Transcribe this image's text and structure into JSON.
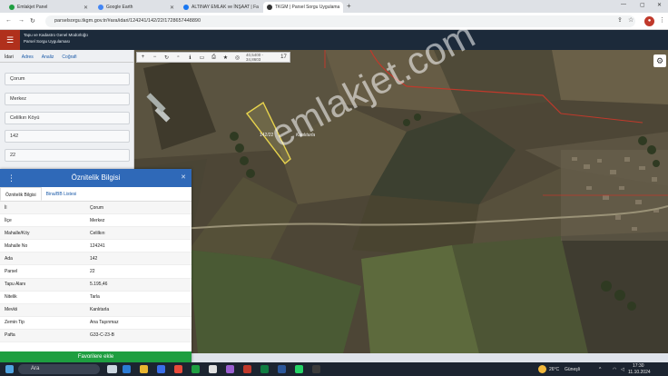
{
  "browser": {
    "tabs": [
      {
        "label": "Emlakjet Panel",
        "color": "#1e9e40"
      },
      {
        "label": "Google Earth",
        "color": "#4285f4"
      },
      {
        "label": "ALTINAY EMLAK ve İNŞAAT | Fa",
        "color": "#1877f2"
      },
      {
        "label": "TKGM | Parsel Sorgu Uygulama",
        "color": "#333333"
      }
    ],
    "url": "parselsorgu.tkgm.gov.tr/#ara/idari/124241/142/22/1728657448890",
    "new_tab": "+",
    "profile_initial": "●"
  },
  "header": {
    "line1": "Tapu ve Kadastro Genel Müdürlüğü",
    "line2": "Parsel Sorgu Uygulaması"
  },
  "left_panel": {
    "tabs": [
      "İdari",
      "Adres",
      "Analiz",
      "Coğrafi"
    ],
    "fields": [
      "Çorum",
      "Merkez",
      "Celilkırı Köyü",
      "142",
      "22"
    ]
  },
  "map": {
    "coords": "40,5400 - 34,8603",
    "zoom_label": "17",
    "kml_label": "Kanlıtarla",
    "watermark": "emlakjet.com",
    "parcel_label": "142/22"
  },
  "popup": {
    "title": "Öznitelik Bilgisi",
    "tabs": [
      "Öznitelik Bilgisi",
      "Bina/BB Listesi"
    ],
    "rows": [
      {
        "key": "İl",
        "value": "Çorum"
      },
      {
        "key": "İlçe",
        "value": "Merkez"
      },
      {
        "key": "Mahalle/Köy",
        "value": "Celilkırı"
      },
      {
        "key": "Mahalle No",
        "value": "124241"
      },
      {
        "key": "Ada",
        "value": "142"
      },
      {
        "key": "Parsel",
        "value": "22"
      },
      {
        "key": "Tapu Alanı",
        "value": "5.195,46"
      },
      {
        "key": "Nitelik",
        "value": "Tarla"
      },
      {
        "key": "Mevkii",
        "value": "Kanlıtarla"
      },
      {
        "key": "Zemin Tip",
        "value": "Ana Taşınmaz"
      },
      {
        "key": "Pafta",
        "value": "G33-C-23-B"
      }
    ],
    "favorite_button": "Favorilere ekle"
  },
  "taskbar": {
    "search_placeholder": "Ara",
    "weather": "26°C",
    "weather_desc": "Güneşli",
    "time": "17:30",
    "date": "11.10.2024"
  }
}
